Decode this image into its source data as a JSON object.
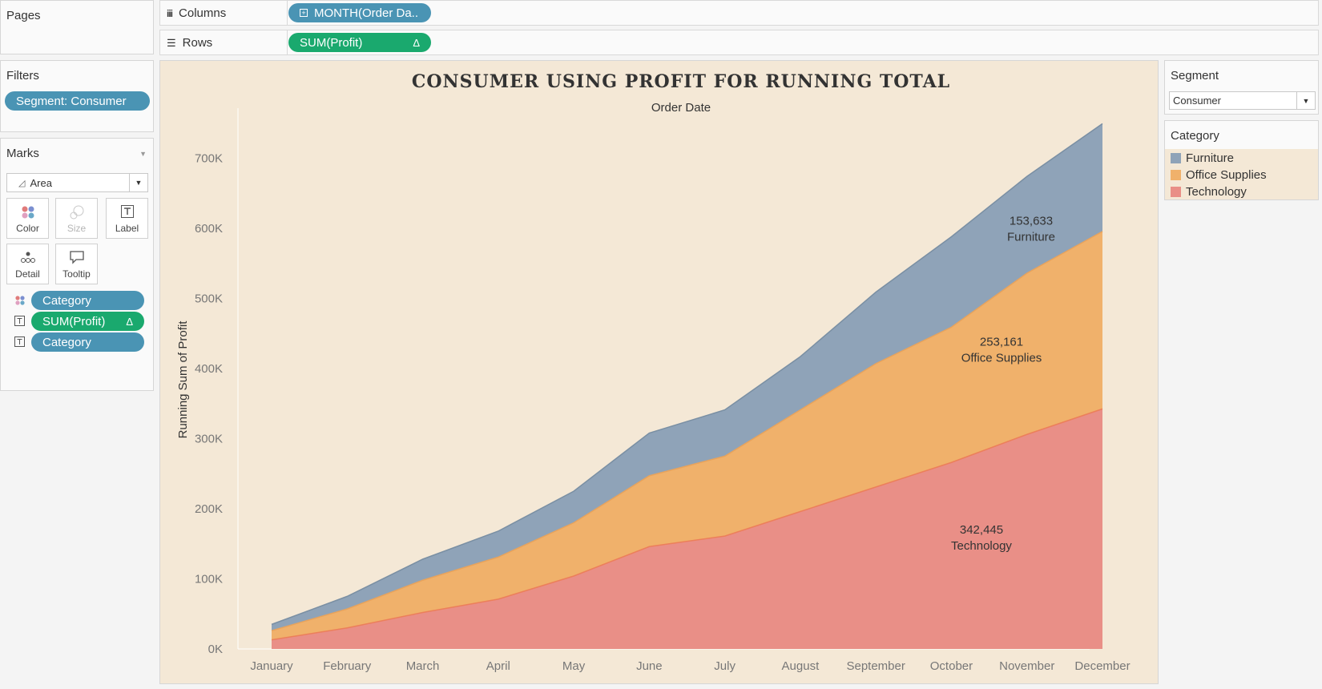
{
  "shelves": {
    "pages_label": "Pages",
    "columns_label": "Columns",
    "rows_label": "Rows",
    "columns_pill": "MONTH(Order Da..",
    "rows_pill": "SUM(Profit)",
    "delta": "Δ"
  },
  "filters": {
    "title": "Filters",
    "pill": "Segment: Consumer"
  },
  "marks": {
    "title": "Marks",
    "type": "Area",
    "buttons": {
      "color": "Color",
      "size": "Size",
      "label": "Label",
      "detail": "Detail",
      "tooltip": "Tooltip"
    },
    "fields": [
      {
        "label": "Category"
      },
      {
        "label": "SUM(Profit)",
        "delta": "Δ"
      },
      {
        "label": "Category"
      }
    ]
  },
  "segment_filter": {
    "title": "Segment",
    "value": "Consumer"
  },
  "legend": {
    "title": "Category",
    "items": [
      {
        "label": "Furniture",
        "color": "#8fa3b8"
      },
      {
        "label": "Office Supplies",
        "color": "#f0b16b"
      },
      {
        "label": "Technology",
        "color": "#e98f87"
      }
    ]
  },
  "chart_data": {
    "type": "area",
    "title": "CONSUMER USING PROFIT FOR RUNNING TOTAL",
    "subtitle": "Order Date",
    "ylabel": "Running Sum of Profit",
    "categories": [
      "January",
      "February",
      "March",
      "April",
      "May",
      "June",
      "July",
      "August",
      "September",
      "October",
      "November",
      "December"
    ],
    "y_ticks": [
      "0K",
      "100K",
      "200K",
      "300K",
      "400K",
      "500K",
      "600K",
      "700K"
    ],
    "ylim": [
      0,
      760000
    ],
    "stacked": true,
    "series": [
      {
        "name": "Technology",
        "color": "#e98f87",
        "line": "#ec7f5a",
        "values": [
          13000,
          30000,
          52000,
          71000,
          104000,
          146000,
          161000,
          196000,
          231000,
          266000,
          306000,
          342445
        ]
      },
      {
        "name": "Office Supplies",
        "color": "#f0b16b",
        "line": "#e8a35c",
        "values": [
          13000,
          27000,
          46000,
          60000,
          76000,
          101000,
          114000,
          145000,
          176000,
          193000,
          230000,
          253161
        ]
      },
      {
        "name": "Furniture",
        "color": "#8fa3b8",
        "line": "#7a8fa3",
        "values": [
          9000,
          18000,
          30000,
          37000,
          45000,
          61000,
          66000,
          76000,
          102000,
          129000,
          138000,
          153633
        ]
      }
    ],
    "labels": [
      {
        "value": "153,633",
        "name": "Furniture"
      },
      {
        "value": "253,161",
        "name": "Office Supplies"
      },
      {
        "value": "342,445",
        "name": "Technology"
      }
    ]
  }
}
